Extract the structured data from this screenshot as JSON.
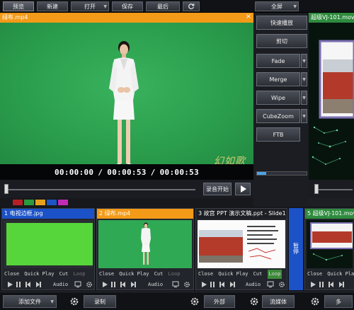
{
  "toolbar": {
    "preview_label": "预览",
    "new_label": "新建",
    "open_label": "打开",
    "save_label": "保存",
    "last_label": "最后",
    "fullscreen_label": "全屏"
  },
  "preview": {
    "title": "绿布.mp4",
    "current_time": "00:00:00",
    "duration": "00:00:53",
    "remaining": "00:00:53",
    "watermark": "幻如歌",
    "record_label": "录音开始",
    "swatch_colors": [
      "#b81f24",
      "#2c9a3b",
      "#e8a21a",
      "#1d55c4",
      "#c02cb3"
    ]
  },
  "transitions": {
    "items": [
      {
        "label": "快速播放"
      },
      {
        "label": "剪切"
      },
      {
        "label": "Fade"
      },
      {
        "label": "Merge"
      },
      {
        "label": "Wipe"
      },
      {
        "label": "CubeZoom"
      },
      {
        "label": "FTB"
      }
    ],
    "slider_value": 0.18
  },
  "program": {
    "title": "超级VJ-101.mov"
  },
  "clips": [
    {
      "number": "1",
      "title": "电视边框.jpg",
      "header_color": "#1b52c8",
      "kind": "green"
    },
    {
      "number": "2",
      "title": "绿布.mp4",
      "header_color": "#f39a18",
      "kind": "person"
    },
    {
      "number": "3",
      "title": "故宫 PPT 演示文稿.ppt - Slide1",
      "header_color": "#1d1f24",
      "kind": "ppt"
    },
    {
      "number": "5",
      "title": "超级VJ-101.mov",
      "header_color": "#2e8b3e",
      "kind": "vj"
    }
  ],
  "clip_controls": {
    "close": "Close",
    "quick_play": "Quick Play",
    "cut": "Cut",
    "loop": "Loop",
    "audio": "Audio"
  },
  "clip4_side_label": "暂停",
  "bottom": {
    "add_file": "添加文件",
    "record": "录制",
    "external": "外部",
    "stream": "流媒体",
    "more": "多"
  },
  "colors": {
    "accent_orange": "#f39a18",
    "accent_green": "#2e8b3e",
    "accent_blue": "#1b52c8"
  }
}
